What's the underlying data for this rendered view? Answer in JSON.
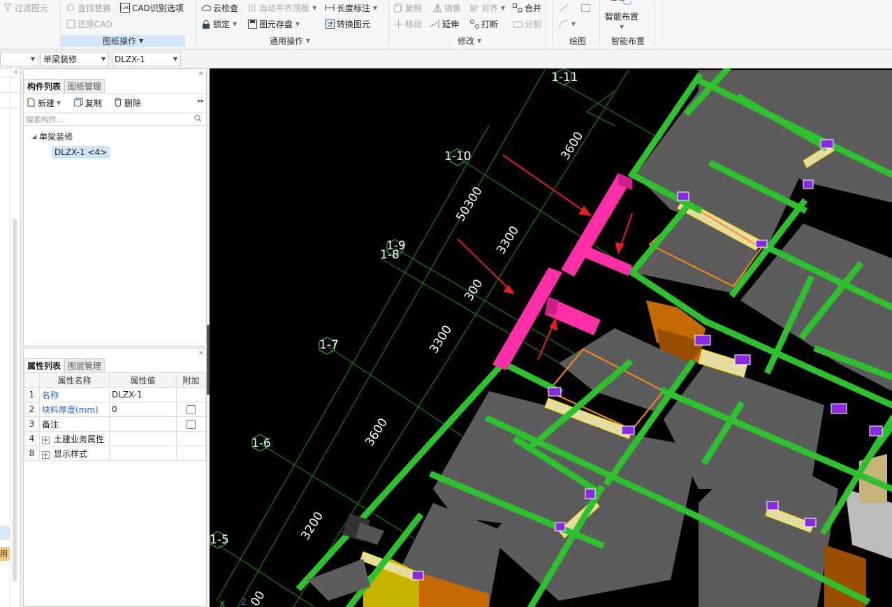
{
  "ribbon": {
    "filter_elements": "过滤图元",
    "find_replace": "查找替换",
    "cad_options": "CAD识别选项",
    "restore_cad": "还原CAD",
    "group_drawing": "图纸操作",
    "cloud_check": "云检查",
    "auto_flush": "自动平齐顶板",
    "length_dim": "长度标注",
    "lock": "锁定",
    "element_save": "图元存盘",
    "convert_element": "转换图元",
    "group_common": "通用操作",
    "copy": "复制",
    "mirror": "镜像",
    "align": "对齐",
    "merge": "合并",
    "move": "移动",
    "extend": "延伸",
    "break": "打断",
    "split": "分割",
    "group_modify": "修改",
    "group_draw": "绘图",
    "smart_layout": "智能布置",
    "group_smart": "智能布置"
  },
  "toolbar2": {
    "combo1": "",
    "combo2": "单梁装修",
    "combo3": "DLZX-1"
  },
  "component_panel": {
    "tab_list": "构件列表",
    "tab_drawing": "图纸管理",
    "new": "新建",
    "copy": "复制",
    "delete": "删除",
    "search_placeholder": "搜索构件...",
    "tree_parent": "单梁装修",
    "tree_child": "DLZX-1 <4>"
  },
  "property_panel": {
    "tab_props": "属性列表",
    "tab_layers": "图层管理",
    "col_name": "属性名称",
    "col_value": "属性值",
    "col_extra": "附加",
    "rows": [
      {
        "num": "1",
        "name": "名称",
        "value": "DLZX-1"
      },
      {
        "num": "2",
        "name": "块料厚度(mm)",
        "value": "0"
      },
      {
        "num": "3",
        "name": "备注",
        "value": ""
      },
      {
        "num": "4",
        "name": "土建业务属性",
        "value": ""
      },
      {
        "num": "8",
        "name": "显示样式",
        "value": ""
      }
    ]
  },
  "left_strip": {
    "partial_label": "用"
  },
  "viewport": {
    "axis_labels": [
      "1-11",
      "1-10",
      "1-9",
      "1-8",
      "1-7",
      "1-6",
      "1-5"
    ],
    "dimensions": [
      "3600",
      "50300",
      "3300",
      "300",
      "3300",
      "3600",
      "3200",
      "00"
    ],
    "axis_x": "X",
    "axis_z": "Z"
  }
}
